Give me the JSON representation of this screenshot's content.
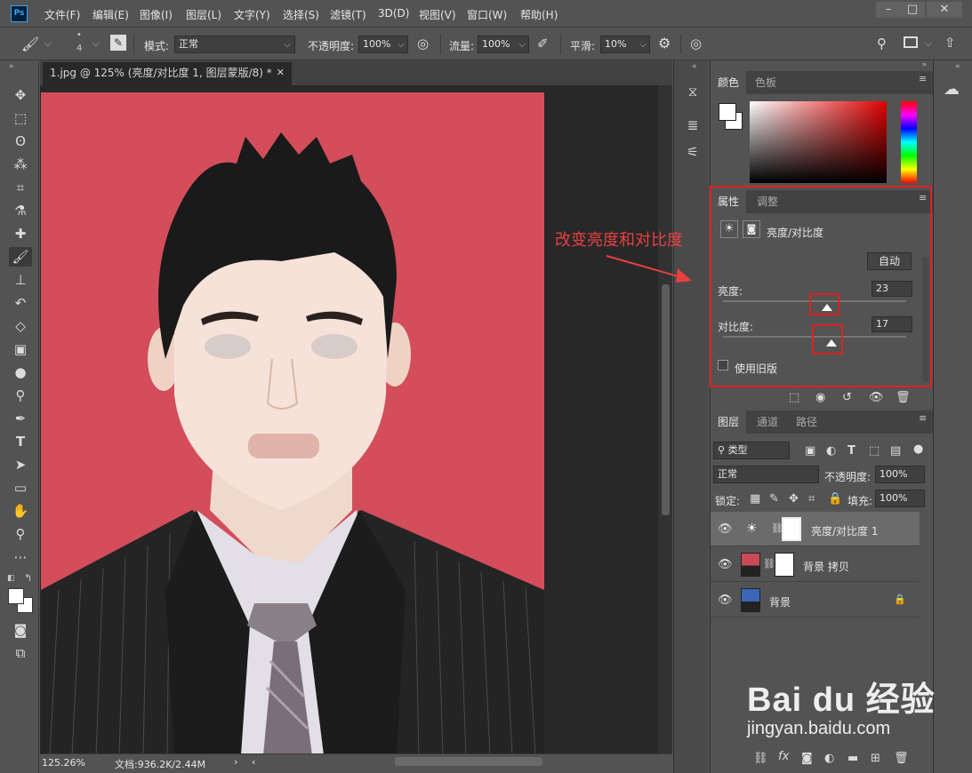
{
  "menubar": {
    "items": [
      "文件(F)",
      "编辑(E)",
      "图像(I)",
      "图层(L)",
      "文字(Y)",
      "选择(S)",
      "滤镜(T)",
      "3D(D)",
      "视图(V)",
      "窗口(W)",
      "帮助(H)"
    ],
    "logo": "Ps"
  },
  "options": {
    "brush_size": "4",
    "mode_label": "模式:",
    "mode_value": "正常",
    "opacity_label": "不透明度:",
    "opacity_value": "100%",
    "flow_label": "流量:",
    "flow_value": "100%",
    "smooth_label": "平滑:",
    "smooth_value": "10%"
  },
  "document": {
    "tab_title": "1.jpg @ 125% (亮度/对比度 1, 图层蒙版/8) *",
    "zoom": "125.26%",
    "doc_size": "文档:936.2K/2.44M"
  },
  "color_panel": {
    "tabs": [
      "颜色",
      "色板"
    ],
    "foreground": "#ffffff",
    "background": "#ffffff"
  },
  "properties_panel": {
    "tabs": [
      "属性",
      "调整"
    ],
    "title": "亮度/对比度",
    "auto_label": "自动",
    "brightness_label": "亮度:",
    "brightness_value": "23",
    "brightness_level": 0.57,
    "contrast_label": "对比度:",
    "contrast_value": "17",
    "contrast_level": 0.59,
    "legacy_label": "使用旧版"
  },
  "annotation": {
    "text": "改变亮度和对比度",
    "color": "#e84040"
  },
  "layers_panel": {
    "tabs": [
      "图层",
      "通道",
      "路径"
    ],
    "filter_label": "类型",
    "blend_mode": "正常",
    "opacity_label": "不透明度:",
    "opacity_value": "100%",
    "lock_label": "锁定:",
    "fill_label": "填充:",
    "fill_value": "100%",
    "layers": [
      {
        "name": "亮度/对比度 1",
        "selected": true
      },
      {
        "name": "背景 拷贝",
        "selected": false
      },
      {
        "name": "背景",
        "selected": false
      }
    ]
  },
  "watermark": {
    "brand": "Bai du 经验",
    "url": "jingyan.baidu.com"
  },
  "colors": {
    "photo_background": "#d44d5b",
    "ui_dark": "#535353",
    "highlight": "#e02020"
  }
}
